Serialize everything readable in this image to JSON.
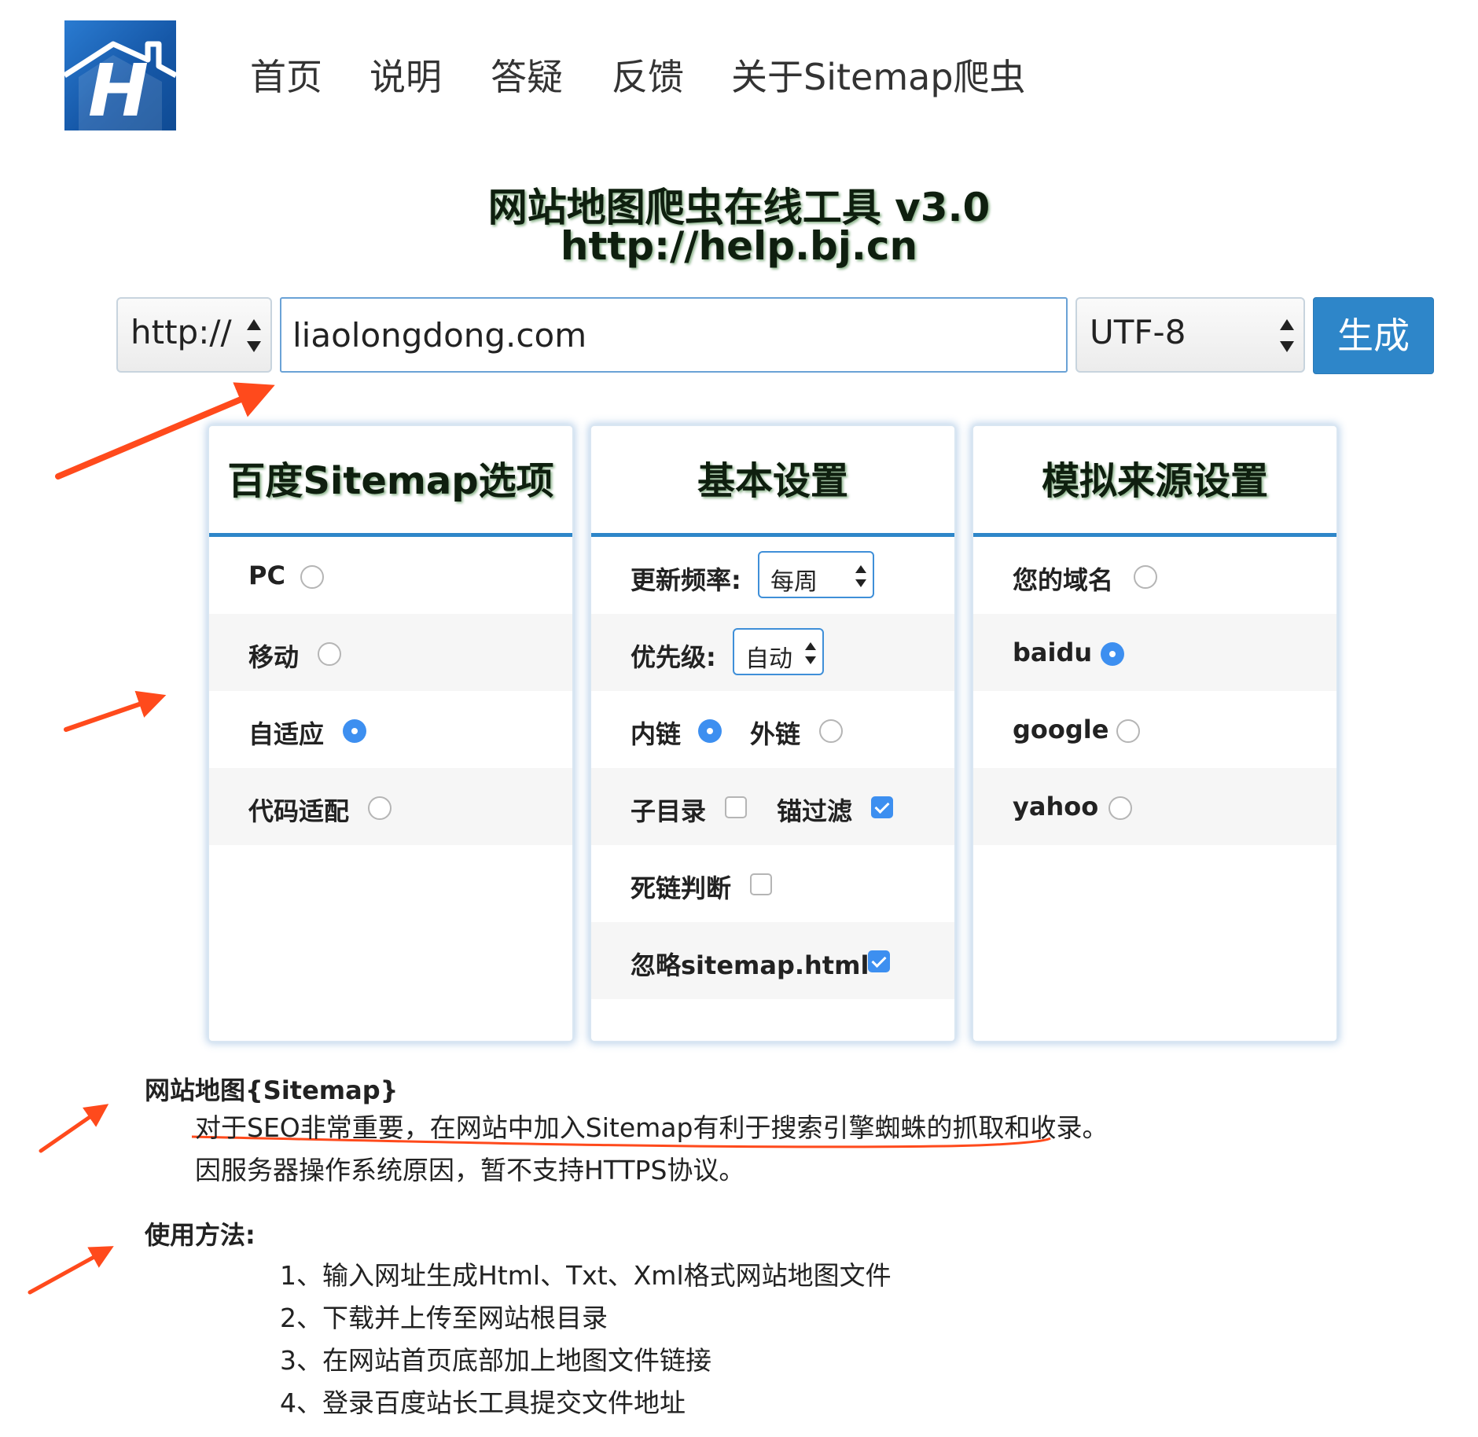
{
  "nav": {
    "logo_letter": "H",
    "items": [
      "首页",
      "说明",
      "答疑",
      "反馈",
      "关于Sitemap爬虫"
    ]
  },
  "title": {
    "line1": "网站地图爬虫在线工具 v3.0",
    "line2": "http://help.bj.cn"
  },
  "form": {
    "protocol": "http://",
    "url_value": "liaolongdong.com",
    "encoding": "UTF-8",
    "generate_label": "生成"
  },
  "panels": {
    "baidu": {
      "title": "百度Sitemap选项",
      "options": [
        {
          "label": "PC",
          "checked": false
        },
        {
          "label": "移动",
          "checked": false
        },
        {
          "label": "自适应",
          "checked": true
        },
        {
          "label": "代码适配",
          "checked": false
        }
      ]
    },
    "basic": {
      "title": "基本设置",
      "freq_label": "更新频率:",
      "freq_value": "每周",
      "priority_label": "优先级:",
      "priority_value": "自动",
      "inner_link_label": "内链",
      "inner_link_checked": true,
      "outer_link_label": "外链",
      "outer_link_checked": false,
      "subdir_label": "子目录",
      "subdir_checked": false,
      "anchor_filter_label": "锚过滤",
      "anchor_filter_checked": true,
      "deadlink_label": "死链判断",
      "deadlink_checked": false,
      "ignore_label": "忽略sitemap.html",
      "ignore_checked": true
    },
    "source": {
      "title": "模拟来源设置",
      "options": [
        {
          "label": "您的域名",
          "checked": false
        },
        {
          "label": "baidu",
          "checked": true
        },
        {
          "label": "google",
          "checked": false
        },
        {
          "label": "yahoo",
          "checked": false
        }
      ]
    }
  },
  "info": {
    "sitemap_heading": "网站地图{Sitemap}",
    "sitemap_line1": "对于SEO非常重要，在网站中加入Sitemap有利于搜索引擎蜘蛛的抓取和收录。",
    "sitemap_line2": "因服务器操作系统原因，暂不支持HTTPS协议。",
    "usage_heading": "使用方法:",
    "usage_steps": [
      "1、输入网址生成Html、Txt、Xml格式网站地图文件",
      "2、下载并上传至网站根目录",
      "3、在网站首页底部加上地图文件链接",
      "4、登录百度站长工具提交文件地址"
    ]
  },
  "colors": {
    "accent": "#2e86c9",
    "radio_on": "#3d8ff0",
    "annotation": "#ff4a1c"
  }
}
